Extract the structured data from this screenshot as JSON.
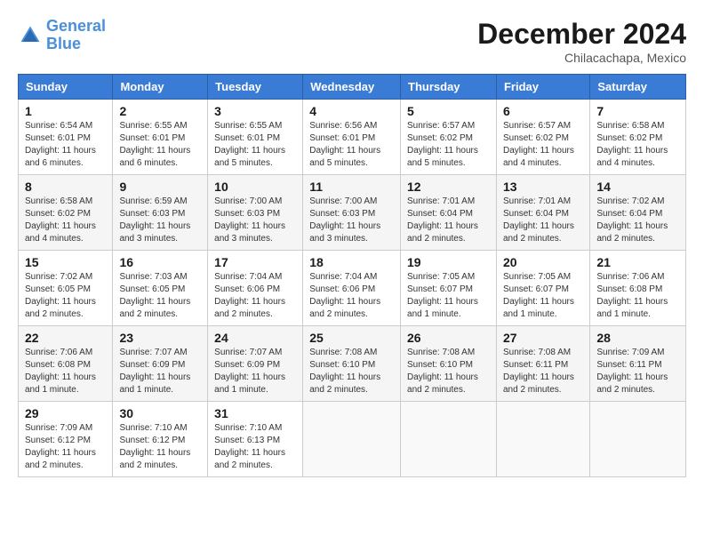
{
  "header": {
    "logo_line1": "General",
    "logo_line2": "Blue",
    "month_year": "December 2024",
    "location": "Chilacachapa, Mexico"
  },
  "days_of_week": [
    "Sunday",
    "Monday",
    "Tuesday",
    "Wednesday",
    "Thursday",
    "Friday",
    "Saturday"
  ],
  "weeks": [
    [
      {
        "day": "1",
        "sunrise": "6:54 AM",
        "sunset": "6:01 PM",
        "daylight": "11 hours and 6 minutes."
      },
      {
        "day": "2",
        "sunrise": "6:55 AM",
        "sunset": "6:01 PM",
        "daylight": "11 hours and 6 minutes."
      },
      {
        "day": "3",
        "sunrise": "6:55 AM",
        "sunset": "6:01 PM",
        "daylight": "11 hours and 5 minutes."
      },
      {
        "day": "4",
        "sunrise": "6:56 AM",
        "sunset": "6:01 PM",
        "daylight": "11 hours and 5 minutes."
      },
      {
        "day": "5",
        "sunrise": "6:57 AM",
        "sunset": "6:02 PM",
        "daylight": "11 hours and 5 minutes."
      },
      {
        "day": "6",
        "sunrise": "6:57 AM",
        "sunset": "6:02 PM",
        "daylight": "11 hours and 4 minutes."
      },
      {
        "day": "7",
        "sunrise": "6:58 AM",
        "sunset": "6:02 PM",
        "daylight": "11 hours and 4 minutes."
      }
    ],
    [
      {
        "day": "8",
        "sunrise": "6:58 AM",
        "sunset": "6:02 PM",
        "daylight": "11 hours and 4 minutes."
      },
      {
        "day": "9",
        "sunrise": "6:59 AM",
        "sunset": "6:03 PM",
        "daylight": "11 hours and 3 minutes."
      },
      {
        "day": "10",
        "sunrise": "7:00 AM",
        "sunset": "6:03 PM",
        "daylight": "11 hours and 3 minutes."
      },
      {
        "day": "11",
        "sunrise": "7:00 AM",
        "sunset": "6:03 PM",
        "daylight": "11 hours and 3 minutes."
      },
      {
        "day": "12",
        "sunrise": "7:01 AM",
        "sunset": "6:04 PM",
        "daylight": "11 hours and 2 minutes."
      },
      {
        "day": "13",
        "sunrise": "7:01 AM",
        "sunset": "6:04 PM",
        "daylight": "11 hours and 2 minutes."
      },
      {
        "day": "14",
        "sunrise": "7:02 AM",
        "sunset": "6:04 PM",
        "daylight": "11 hours and 2 minutes."
      }
    ],
    [
      {
        "day": "15",
        "sunrise": "7:02 AM",
        "sunset": "6:05 PM",
        "daylight": "11 hours and 2 minutes."
      },
      {
        "day": "16",
        "sunrise": "7:03 AM",
        "sunset": "6:05 PM",
        "daylight": "11 hours and 2 minutes."
      },
      {
        "day": "17",
        "sunrise": "7:04 AM",
        "sunset": "6:06 PM",
        "daylight": "11 hours and 2 minutes."
      },
      {
        "day": "18",
        "sunrise": "7:04 AM",
        "sunset": "6:06 PM",
        "daylight": "11 hours and 2 minutes."
      },
      {
        "day": "19",
        "sunrise": "7:05 AM",
        "sunset": "6:07 PM",
        "daylight": "11 hours and 1 minute."
      },
      {
        "day": "20",
        "sunrise": "7:05 AM",
        "sunset": "6:07 PM",
        "daylight": "11 hours and 1 minute."
      },
      {
        "day": "21",
        "sunrise": "7:06 AM",
        "sunset": "6:08 PM",
        "daylight": "11 hours and 1 minute."
      }
    ],
    [
      {
        "day": "22",
        "sunrise": "7:06 AM",
        "sunset": "6:08 PM",
        "daylight": "11 hours and 1 minute."
      },
      {
        "day": "23",
        "sunrise": "7:07 AM",
        "sunset": "6:09 PM",
        "daylight": "11 hours and 1 minute."
      },
      {
        "day": "24",
        "sunrise": "7:07 AM",
        "sunset": "6:09 PM",
        "daylight": "11 hours and 1 minute."
      },
      {
        "day": "25",
        "sunrise": "7:08 AM",
        "sunset": "6:10 PM",
        "daylight": "11 hours and 2 minutes."
      },
      {
        "day": "26",
        "sunrise": "7:08 AM",
        "sunset": "6:10 PM",
        "daylight": "11 hours and 2 minutes."
      },
      {
        "day": "27",
        "sunrise": "7:08 AM",
        "sunset": "6:11 PM",
        "daylight": "11 hours and 2 minutes."
      },
      {
        "day": "28",
        "sunrise": "7:09 AM",
        "sunset": "6:11 PM",
        "daylight": "11 hours and 2 minutes."
      }
    ],
    [
      {
        "day": "29",
        "sunrise": "7:09 AM",
        "sunset": "6:12 PM",
        "daylight": "11 hours and 2 minutes."
      },
      {
        "day": "30",
        "sunrise": "7:10 AM",
        "sunset": "6:12 PM",
        "daylight": "11 hours and 2 minutes."
      },
      {
        "day": "31",
        "sunrise": "7:10 AM",
        "sunset": "6:13 PM",
        "daylight": "11 hours and 2 minutes."
      },
      null,
      null,
      null,
      null
    ]
  ]
}
